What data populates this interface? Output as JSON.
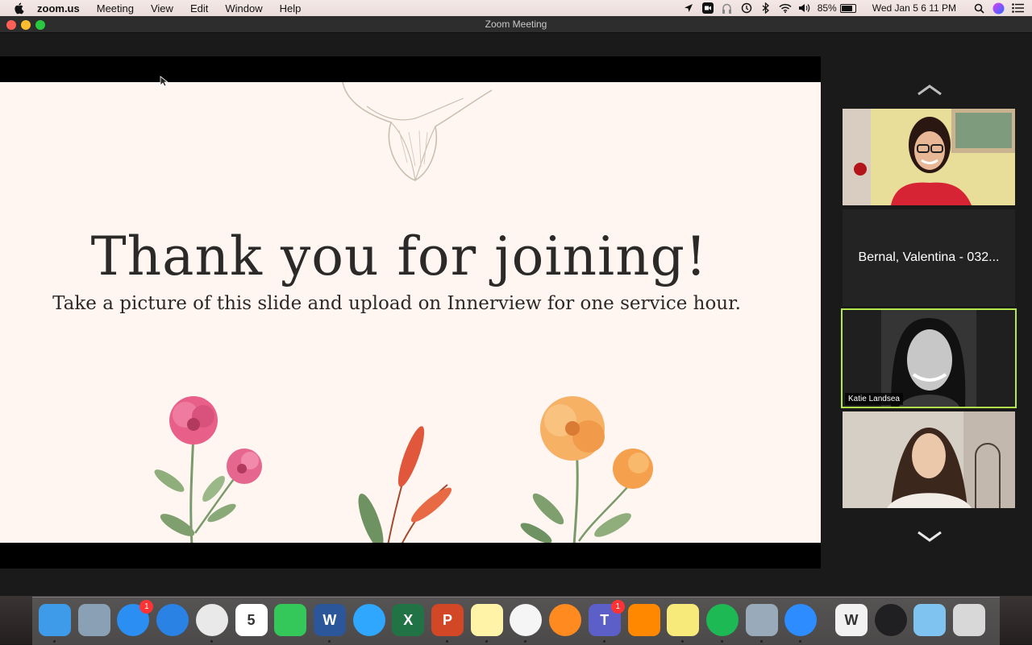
{
  "menubar": {
    "app_name": "zoom.us",
    "items": [
      "Meeting",
      "View",
      "Edit",
      "Window",
      "Help"
    ],
    "battery": "85%",
    "clock": "Wed Jan 5  6 11 PM"
  },
  "window": {
    "title": "Zoom Meeting"
  },
  "slide": {
    "title": "Thank you for joining!",
    "subtitle": "Take a picture of this slide and upload on Innerview for one service hour."
  },
  "participants": [
    {
      "type": "video",
      "name": ""
    },
    {
      "type": "name",
      "name": "Bernal, Valentina - 032..."
    },
    {
      "type": "video",
      "name": "Katie Landsea",
      "active": true
    },
    {
      "type": "video",
      "name": ""
    }
  ],
  "dock": {
    "items": [
      {
        "name": "finder-icon",
        "color": "#3d9be9",
        "label": "",
        "running": true
      },
      {
        "name": "preview-icon",
        "color": "#8aa0b5",
        "label": "",
        "running": false
      },
      {
        "name": "app-store-icon",
        "color": "#2b8ef3",
        "label": "",
        "badge": "1",
        "running": false
      },
      {
        "name": "safari-icon",
        "color": "#2a82e4",
        "label": "",
        "running": false
      },
      {
        "name": "chrome-icon",
        "color": "#e9e9e9",
        "label": "",
        "running": true
      },
      {
        "name": "calendar-icon",
        "color": "#ffffff",
        "label": "5",
        "running": false
      },
      {
        "name": "facetime-icon",
        "color": "#34c759",
        "label": "",
        "running": false
      },
      {
        "name": "word-icon",
        "color": "#2b579a",
        "label": "W",
        "running": true
      },
      {
        "name": "messages-icon",
        "color": "#2fa7ff",
        "label": "",
        "running": false
      },
      {
        "name": "excel-icon",
        "color": "#217346",
        "label": "X",
        "running": false
      },
      {
        "name": "powerpoint-icon",
        "color": "#d24726",
        "label": "P",
        "running": true
      },
      {
        "name": "notes-icon",
        "color": "#fff3a8",
        "label": "",
        "running": true
      },
      {
        "name": "photos-icon",
        "color": "#f5f5f5",
        "label": "",
        "running": true
      },
      {
        "name": "books-icon",
        "color": "#ff8a1f",
        "label": "",
        "running": false
      },
      {
        "name": "teams-icon",
        "color": "#5b5fc7",
        "label": "T",
        "badge": "1",
        "running": true
      },
      {
        "name": "vlc-icon",
        "color": "#ff8800",
        "label": "",
        "running": false
      },
      {
        "name": "stickies-icon",
        "color": "#f7ea7a",
        "label": "",
        "running": true
      },
      {
        "name": "spotify-icon",
        "color": "#1db954",
        "label": "",
        "running": true
      },
      {
        "name": "image-capture-icon",
        "color": "#9ab",
        "label": "",
        "running": true
      },
      {
        "name": "zoom-icon",
        "color": "#2d8cff",
        "label": "",
        "running": true
      },
      {
        "name": "word-document-icon",
        "color": "#f2f2f2",
        "label": "W",
        "running": false
      },
      {
        "name": "security-app-icon",
        "color": "#202022",
        "label": "",
        "running": false
      },
      {
        "name": "folder-icon",
        "color": "#7fc4f0",
        "label": "",
        "running": false
      },
      {
        "name": "trash-icon",
        "color": "#d8d8d8",
        "label": "",
        "running": false
      }
    ]
  }
}
